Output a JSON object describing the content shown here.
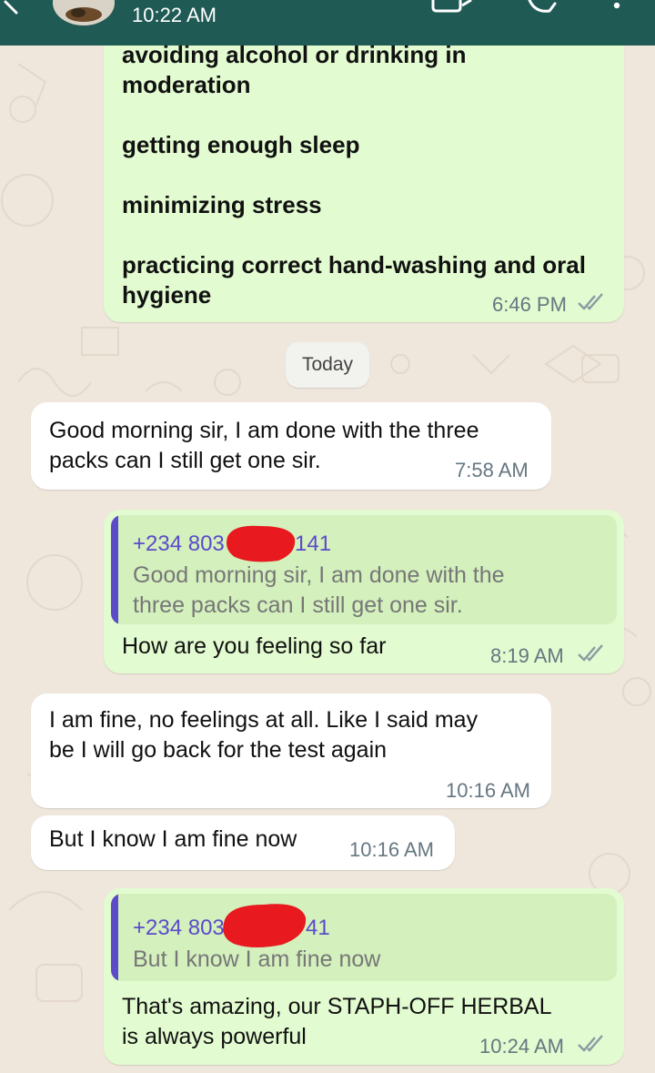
{
  "topbar": {
    "time": "10:22 AM"
  },
  "first_message": {
    "lines": [
      "avoiding alcohol or drinking in",
      "moderation",
      "getting enough sleep",
      "minimizing stress",
      "practicing correct hand-washing and oral",
      "hygiene"
    ],
    "time": "6:46 PM"
  },
  "date_chip": "Today",
  "messages": [
    {
      "lines": [
        "Good morning sir, I am done with the three",
        "packs can I still get one sir."
      ],
      "time": "7:58 AM"
    },
    {
      "quote_name_start": "+234 803",
      "quote_name_end": "141",
      "quote_lines": [
        "Good morning sir, I am done with the",
        "three packs can I still get one sir."
      ],
      "text": "How are you feeling so far",
      "time": "8:19 AM"
    },
    {
      "lines": [
        "I am fine, no feelings at all. Like I said may",
        "be I will go back for the test again"
      ],
      "time": "10:16 AM"
    },
    {
      "text": "But I know I am fine now",
      "time": "10:16 AM"
    },
    {
      "quote_name_start": "+234 803",
      "quote_name_end": "41",
      "quote_text": "But I know I am fine now",
      "lines": [
        "That's amazing, our STAPH-OFF HERBAL",
        "is always powerful"
      ],
      "time": "10:24 AM"
    }
  ],
  "colors": {
    "header": "#1f5a55",
    "outgoing": "#e2fbd0",
    "incoming": "#ffffff",
    "quote_accent": "#5b4bc9",
    "redaction": "#e8191f",
    "read_ticks": "#8a9aa3"
  },
  "icons": [
    "back-arrow-icon",
    "avatar",
    "video-call-icon",
    "voice-call-icon",
    "more-options-icon",
    "read-ticks-icon"
  ]
}
